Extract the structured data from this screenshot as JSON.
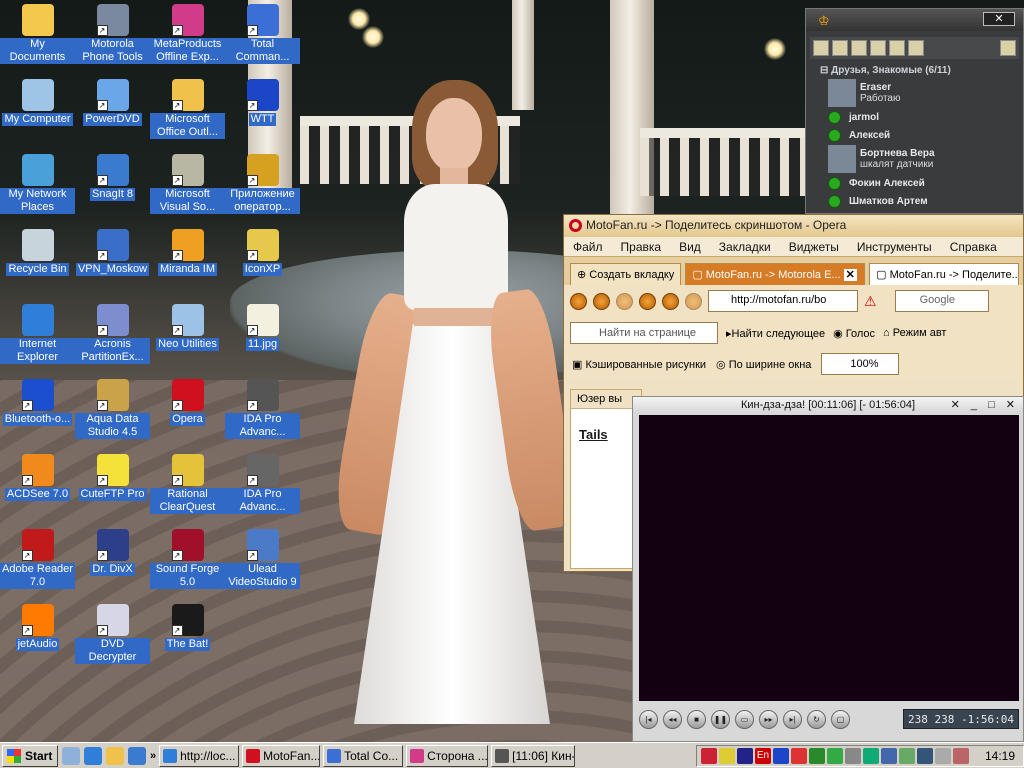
{
  "desktop": {
    "icons": [
      {
        "label": "My Documents",
        "color": "#f2c94c"
      },
      {
        "label": "My Computer",
        "color": "#9ec4e6"
      },
      {
        "label": "My Network Places",
        "color": "#4aa0d8"
      },
      {
        "label": "Recycle Bin",
        "color": "#c8d4dc"
      },
      {
        "label": "Internet Explorer",
        "color": "#2f7fd8"
      },
      {
        "label": "Bluetooth-o...",
        "color": "#1c4fd0"
      },
      {
        "label": "ACDSee 7.0",
        "color": "#f08a1c"
      },
      {
        "label": "Adobe Reader 7.0",
        "color": "#c01a1a"
      },
      {
        "label": "jetAudio",
        "color": "#ff7a00"
      },
      {
        "label": "Motorola Phone Tools",
        "color": "#7a88a0"
      },
      {
        "label": "PowerDVD",
        "color": "#6aa6e8"
      },
      {
        "label": "SnagIt 8",
        "color": "#3a7bd0"
      },
      {
        "label": "VPN_Moskow",
        "color": "#3b6ec8"
      },
      {
        "label": "Acronis PartitionEx...",
        "color": "#7c8ed0"
      },
      {
        "label": "Aqua Data Studio 4.5",
        "color": "#c9a24a"
      },
      {
        "label": "CuteFTP Pro",
        "color": "#f4e23a"
      },
      {
        "label": "Dr. DivX",
        "color": "#2e3f8a"
      },
      {
        "label": "DVD Decrypter",
        "color": "#d6d6e6"
      },
      {
        "label": "MetaProducts Offline Exp...",
        "color": "#d23a8a"
      },
      {
        "label": "Microsoft Office Outl...",
        "color": "#f0c24a"
      },
      {
        "label": "Microsoft Visual So...",
        "color": "#b7b7a4"
      },
      {
        "label": "Miranda IM",
        "color": "#f0a020"
      },
      {
        "label": "Neo Utilities",
        "color": "#9cc2e8"
      },
      {
        "label": "Opera",
        "color": "#d0101e"
      },
      {
        "label": "Rational ClearQuest",
        "color": "#e4c23a"
      },
      {
        "label": "Sound Forge 5.0",
        "color": "#a0102a"
      },
      {
        "label": "The Bat!",
        "color": "#1a1a1a"
      },
      {
        "label": "Total Comman...",
        "color": "#3c6fd6"
      },
      {
        "label": "WTT",
        "color": "#1c46c8"
      },
      {
        "label": "Приложение оператор...",
        "color": "#d6a020"
      },
      {
        "label": "IconXP",
        "color": "#e6c84a"
      },
      {
        "label": "11.jpg",
        "color": "#f4f0e0"
      },
      {
        "label": "IDA Pro Advanc...",
        "color": "#555555"
      },
      {
        "label": "IDA Pro Advanc...",
        "color": "#666666"
      },
      {
        "label": "Ulead VideoStudio 9",
        "color": "#4a7ac8"
      }
    ]
  },
  "miranda": {
    "group_label": "Друзья, Знакомые",
    "group_count": "(6/11)",
    "contacts": [
      {
        "name": "Eraser",
        "status": "Работаю"
      },
      {
        "name": "jarmol",
        "status": ""
      },
      {
        "name": "Алексей",
        "status": ""
      },
      {
        "name": "Бортнева Вера",
        "status": "шкалят датчики"
      },
      {
        "name": "Фокин Алексей",
        "status": ""
      },
      {
        "name": "Шматков Артем",
        "status": ""
      }
    ]
  },
  "opera": {
    "title": "MotoFan.ru -> Поделитесь скриншотом - Opera",
    "menu": [
      "Файл",
      "Правка",
      "Вид",
      "Закладки",
      "Виджеты",
      "Инструменты",
      "Справка"
    ],
    "tabs": {
      "new_tab": "Создать вкладку",
      "tab1": "MotoFan.ru -> Motorola E...",
      "tab2": "MotoFan.ru -> Поделите..."
    },
    "address": "http://motofan.ru/bo",
    "search_placeholder": "Google",
    "find_placeholder": "Найти на странице",
    "find_next": "Найти следующее",
    "voice": "Голос",
    "mode": "Режим авт",
    "cached_images": "Кэшированные рисунки",
    "fit_width": "По ширине окна",
    "zoom": "100%",
    "content_header": "Юзер вы",
    "content_link": "Tails"
  },
  "player": {
    "title": "Кин-дза-дза! [00:11:06] [- 01:56:04]",
    "timer": "238  238  -1:56:04"
  },
  "taskbar": {
    "start": "Start",
    "buttons": [
      {
        "label": "http://loc...",
        "color": "#2f7fd8",
        "width": 80
      },
      {
        "label": "MotoFan....",
        "color": "#d0101e",
        "width": 78
      },
      {
        "label": "Total Co...",
        "color": "#3c6fd6",
        "width": 80
      },
      {
        "label": "Сторона ...",
        "color": "#d23a8a",
        "width": 82
      },
      {
        "label": "[11:06] Кин-...",
        "color": "#555555",
        "width": 84
      }
    ],
    "clock": "14:19",
    "tray_lang": "En"
  }
}
